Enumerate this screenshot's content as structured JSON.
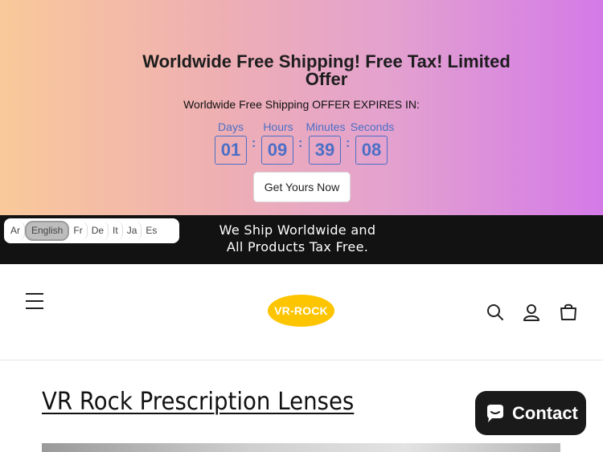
{
  "promo": {
    "title": "Worldwide Free Shipping! Free Tax! Limited Offer",
    "subtitle": "Worldwide Free Shipping OFFER EXPIRES IN:",
    "countdown": [
      {
        "label": "Days",
        "value": "01"
      },
      {
        "label": "Hours",
        "value": "09"
      },
      {
        "label": "Minutes",
        "value": "39"
      },
      {
        "label": "Seconds",
        "value": "08"
      }
    ],
    "cta_label": "Get Yours Now",
    "colors": {
      "accent": "#4b6fc6",
      "gradient_start": "#f9c99a",
      "gradient_end": "#d47ae8"
    }
  },
  "announcement": {
    "text": "We Ship Worldwide and All Products Tax Free."
  },
  "languages": {
    "items": [
      "Ar",
      "English",
      "Fr",
      "De",
      "It",
      "Ja",
      "Es"
    ],
    "selected": "English"
  },
  "header": {
    "logo_text": "VR-ROCK",
    "logo_color": "#fdc400",
    "icons": [
      "menu-icon",
      "search-icon",
      "account-icon",
      "cart-icon"
    ]
  },
  "page": {
    "title": "VR Rock Prescription Lenses"
  },
  "chat": {
    "label": "Contact"
  }
}
